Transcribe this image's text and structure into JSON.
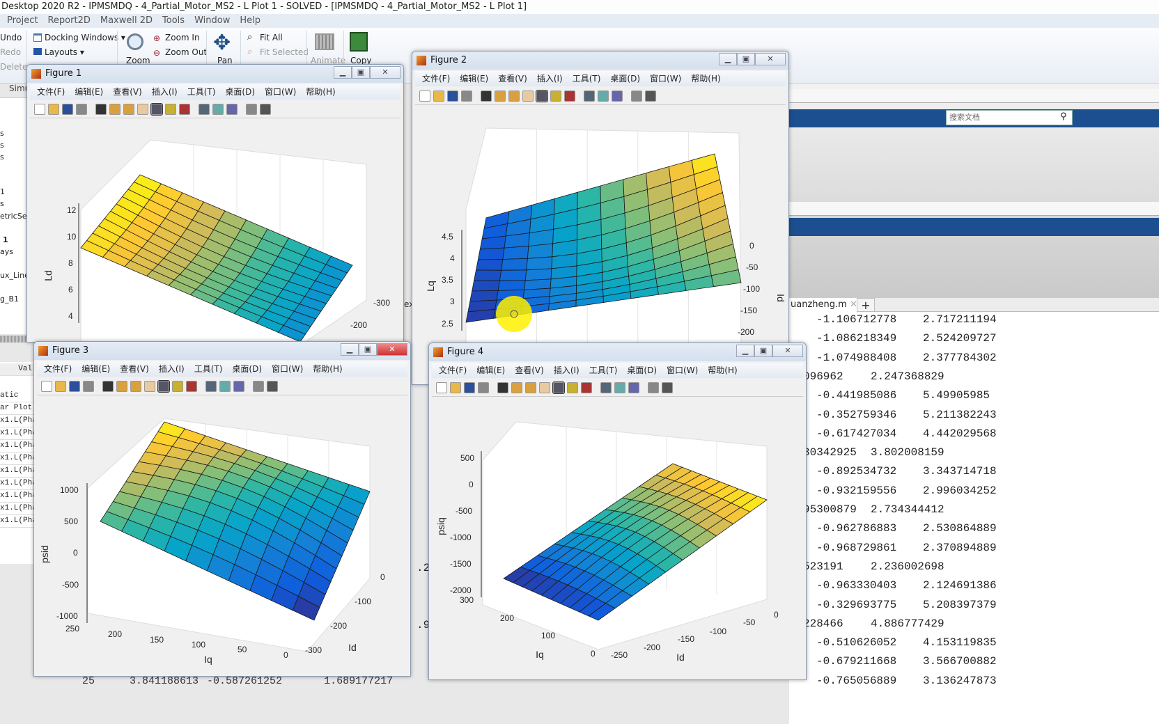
{
  "app": {
    "title": "Desktop 2020 R2 - IPMSMDQ - 4_Partial_Motor_MS2 - L Plot 1 - SOLVED - [IPMSMDQ - 4_Partial_Motor_MS2 - L Plot 1]",
    "menu": [
      "Project",
      "Report2D",
      "Maxwell 2D",
      "Tools",
      "Window",
      "Help"
    ],
    "ribbon": {
      "undo": "Undo",
      "redo": "Redo",
      "delete": "Delete",
      "docking": "Docking Windows",
      "layouts": "Layouts",
      "zoom": "Zoom",
      "zoom_in": "Zoom In",
      "zoom_out": "Zoom Out",
      "pan": "Pan",
      "fit_all": "Fit All",
      "fit_selected": "Fit Selected",
      "animate": "Animate",
      "copy": "Copy",
      "tab_simu": "Simu"
    }
  },
  "tree": [
    "s",
    "s",
    "s",
    "1",
    "s",
    "etricSetu",
    "1",
    "ays",
    "ux_Lines",
    "g_B1"
  ],
  "props": {
    "header": "Val",
    "rows": [
      "atic",
      "ar Plot",
      "x1.L(Pha",
      "x1.L(Pha",
      "x1.L(Pha",
      "x1.L(Pha",
      "x1.L(Pha",
      "x1.L(Pha",
      "x1.L(Pha",
      "x1.L(Pha",
      "x1.L(Pha"
    ]
  },
  "background_text": {
    "t1": "ex",
    "t2": ".25",
    "t3": ".95",
    "bottom": [
      "25",
      "3.841188613",
      "-0.587261252",
      "1.689177217"
    ]
  },
  "doc_panel": {
    "search_placeholder": "搜索文档"
  },
  "editor": {
    "tab": "uanzheng.m",
    "add_tab": "+",
    "rows": [
      {
        "a": "-1.106712778",
        "b": "2.717211194"
      },
      {
        "a": "-1.086218349",
        "b": "2.524209727"
      },
      {
        "a": "-1.074988408",
        "b": "2.377784302"
      },
      {
        "a": "096962",
        "b": "2.247368829",
        "cut": true
      },
      {
        "a": "-0.441985086",
        "b": "5.49905985"
      },
      {
        "a": "-0.352759346",
        "b": "5.211382243"
      },
      {
        "a": "-0.617427034",
        "b": "4.442029568"
      },
      {
        "a": "80342925",
        "b": "3.802008159",
        "cut": true
      },
      {
        "a": "-0.892534732",
        "b": "3.343714718"
      },
      {
        "a": "-0.932159556",
        "b": "2.996034252"
      },
      {
        "a": "95300879",
        "b": "2.734344412",
        "cut": true
      },
      {
        "a": "-0.962786883",
        "b": "2.530864889"
      },
      {
        "a": "-0.968729861",
        "b": "2.370894889"
      },
      {
        "a": "523191",
        "b": "2.236002698",
        "cut": true
      },
      {
        "a": "-0.963330403",
        "b": "2.124691386"
      },
      {
        "a": "-0.329693775",
        "b": "5.208397379"
      },
      {
        "a": "228466",
        "b": "4.886777429",
        "cut": true
      },
      {
        "a": "-0.510626052",
        "b": "4.153119835"
      },
      {
        "a": "-0.679211668",
        "b": "3.566700882"
      },
      {
        "a": "-0.765056889",
        "b": "3.136247873"
      }
    ]
  },
  "figure_menu": [
    "文件(F)",
    "编辑(E)",
    "查看(V)",
    "插入(I)",
    "工具(T)",
    "桌面(D)",
    "窗口(W)",
    "帮助(H)"
  ],
  "figure_toolbar": [
    "new-icon",
    "open-icon",
    "save-icon",
    "print-icon",
    "pointer-icon",
    "zoom-in-icon",
    "zoom-out-icon",
    "pan-icon",
    "rotate-icon",
    "data-cursor-icon",
    "brush-icon",
    "link-icon",
    "colorbar-icon",
    "legend-icon",
    "hide-plot-tools-icon",
    "show-plot-tools-icon"
  ],
  "colormap": [
    "#352a87",
    "#0f5cdd",
    "#1481d6",
    "#06a4ca",
    "#2eb7a4",
    "#87bf77",
    "#d1bb59",
    "#fec832",
    "#f9fb0e"
  ],
  "figures": [
    {
      "title": "Figure 1",
      "active": false,
      "zlabel": "Ld",
      "zticks": [
        "12",
        "10",
        "8",
        "6",
        "4"
      ],
      "xlabel": "",
      "xticks": [],
      "ylabel": "",
      "yticks": [
        "-300",
        "-200"
      ]
    },
    {
      "title": "Figure 2",
      "active": false,
      "zlabel": "Lq",
      "zticks": [
        "4.5",
        "4",
        "3.5",
        "3",
        "2.5"
      ],
      "xlabel": "",
      "xticks": [],
      "ylabel": "Id",
      "yticks": [
        "0",
        "-50",
        "-100",
        "-150",
        "-200"
      ]
    },
    {
      "title": "Figure 3",
      "active": true,
      "zlabel": "psid",
      "zticks": [
        "1000",
        "500",
        "0",
        "-500",
        "-1000"
      ],
      "xlabel": "Iq",
      "xticks": [
        "250",
        "200",
        "150",
        "100",
        "50",
        "0"
      ],
      "ylabel": "Id",
      "yticks": [
        "0",
        "-100",
        "-200",
        "-300"
      ]
    },
    {
      "title": "Figure 4",
      "active": false,
      "zlabel": "psiq",
      "zticks": [
        "500",
        "0",
        "-500",
        "-1000",
        "-1500",
        "-2000"
      ],
      "xlabel": "Iq",
      "xticks": [
        "300",
        "200",
        "100",
        "0"
      ],
      "ylabel": "Id",
      "yticks": [
        "0",
        "-50",
        "-100",
        "-150",
        "-200",
        "-250"
      ]
    }
  ]
}
